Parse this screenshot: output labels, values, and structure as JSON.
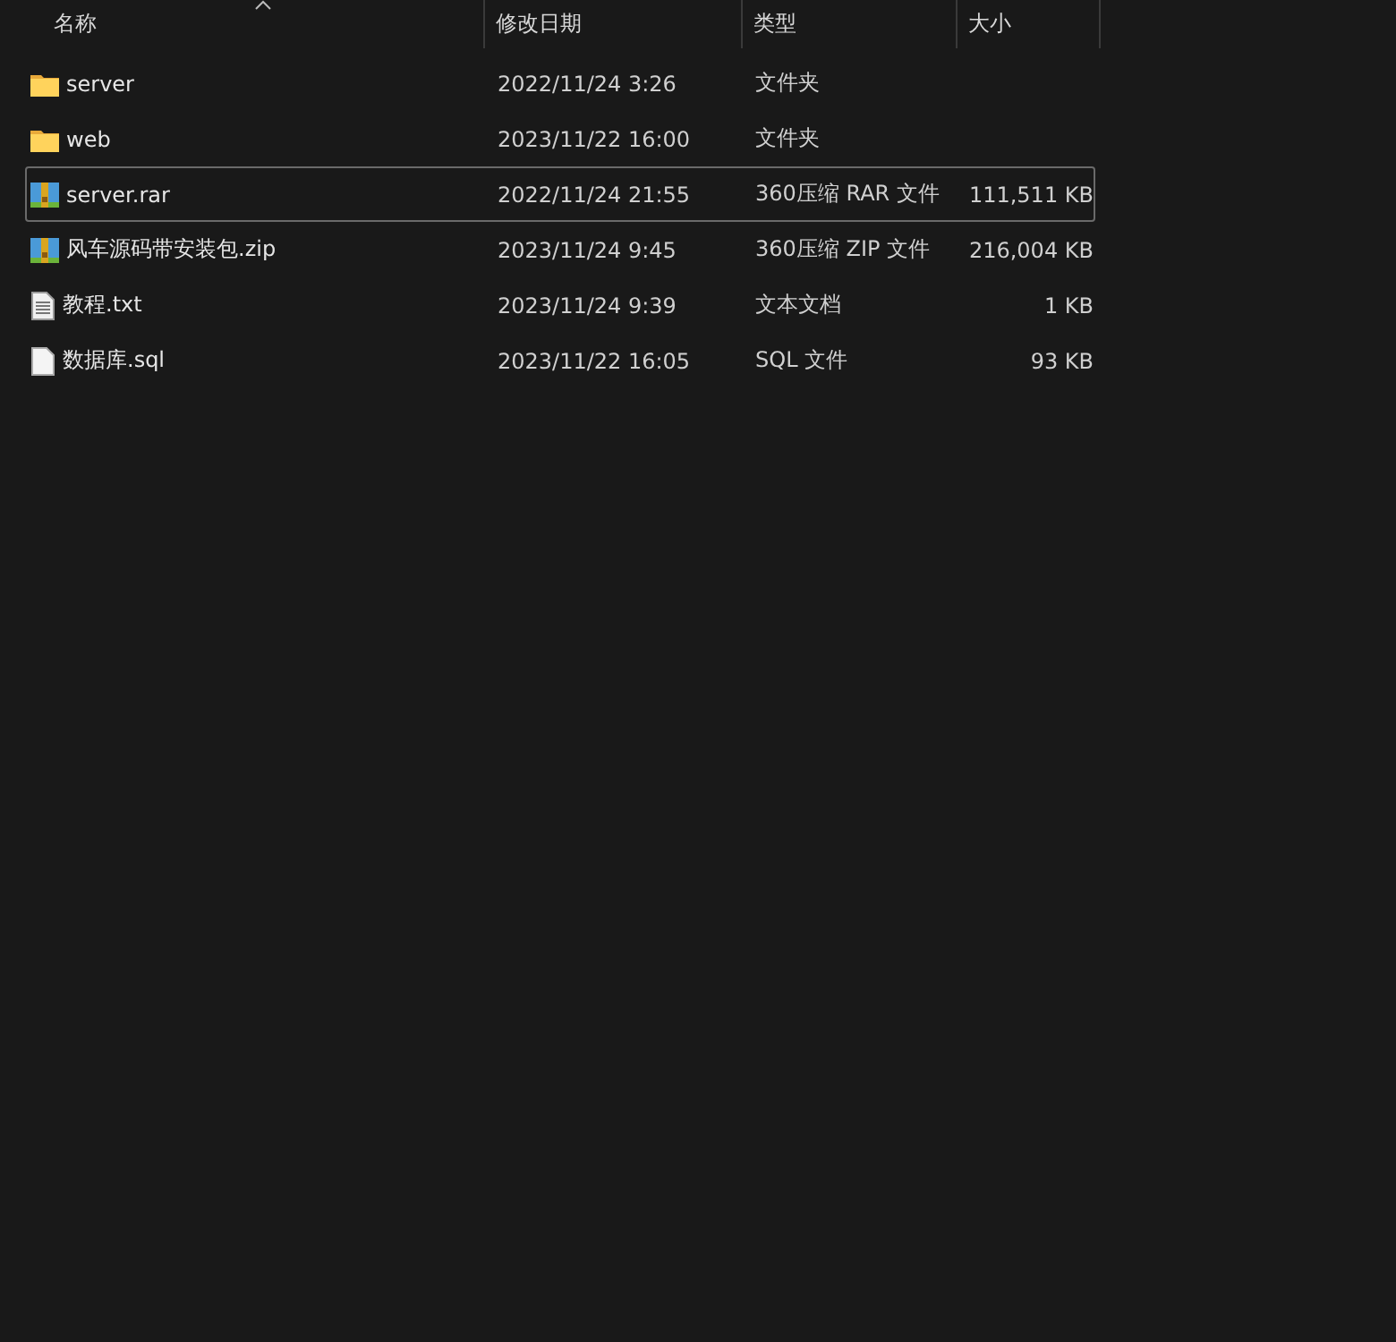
{
  "columns": [
    {
      "label": "名称",
      "sorted": true
    },
    {
      "label": "修改日期",
      "sorted": false
    },
    {
      "label": "类型",
      "sorted": false
    },
    {
      "label": "大小",
      "sorted": false
    }
  ],
  "files": [
    {
      "kind": "folder",
      "name": "server",
      "modified": "2022/11/24 3:26",
      "type": "文件夹",
      "focused": false
    },
    {
      "kind": "folder",
      "name": "web",
      "modified": "2023/11/22 16:00",
      "type": "文件夹",
      "focused": false
    },
    {
      "kind": "archive",
      "name": "server.rar",
      "modified": "2022/11/24 21:55",
      "type": "360压缩 RAR 文件",
      "size": "111,511 KB",
      "focused": true
    },
    {
      "kind": "archive",
      "name": "风车源码带安装包.zip",
      "modified": "2023/11/24 9:45",
      "type": "360压缩 ZIP 文件",
      "size": "216,004 KB",
      "focused": false
    },
    {
      "kind": "text",
      "name": "教程.txt",
      "modified": "2023/11/24 9:39",
      "type": "文本文档",
      "size": "1 KB",
      "focused": false
    },
    {
      "kind": "blank",
      "name": "数据库.sql",
      "modified": "2023/11/22 16:05",
      "type": "SQL 文件",
      "size": "93 KB",
      "focused": false
    }
  ]
}
